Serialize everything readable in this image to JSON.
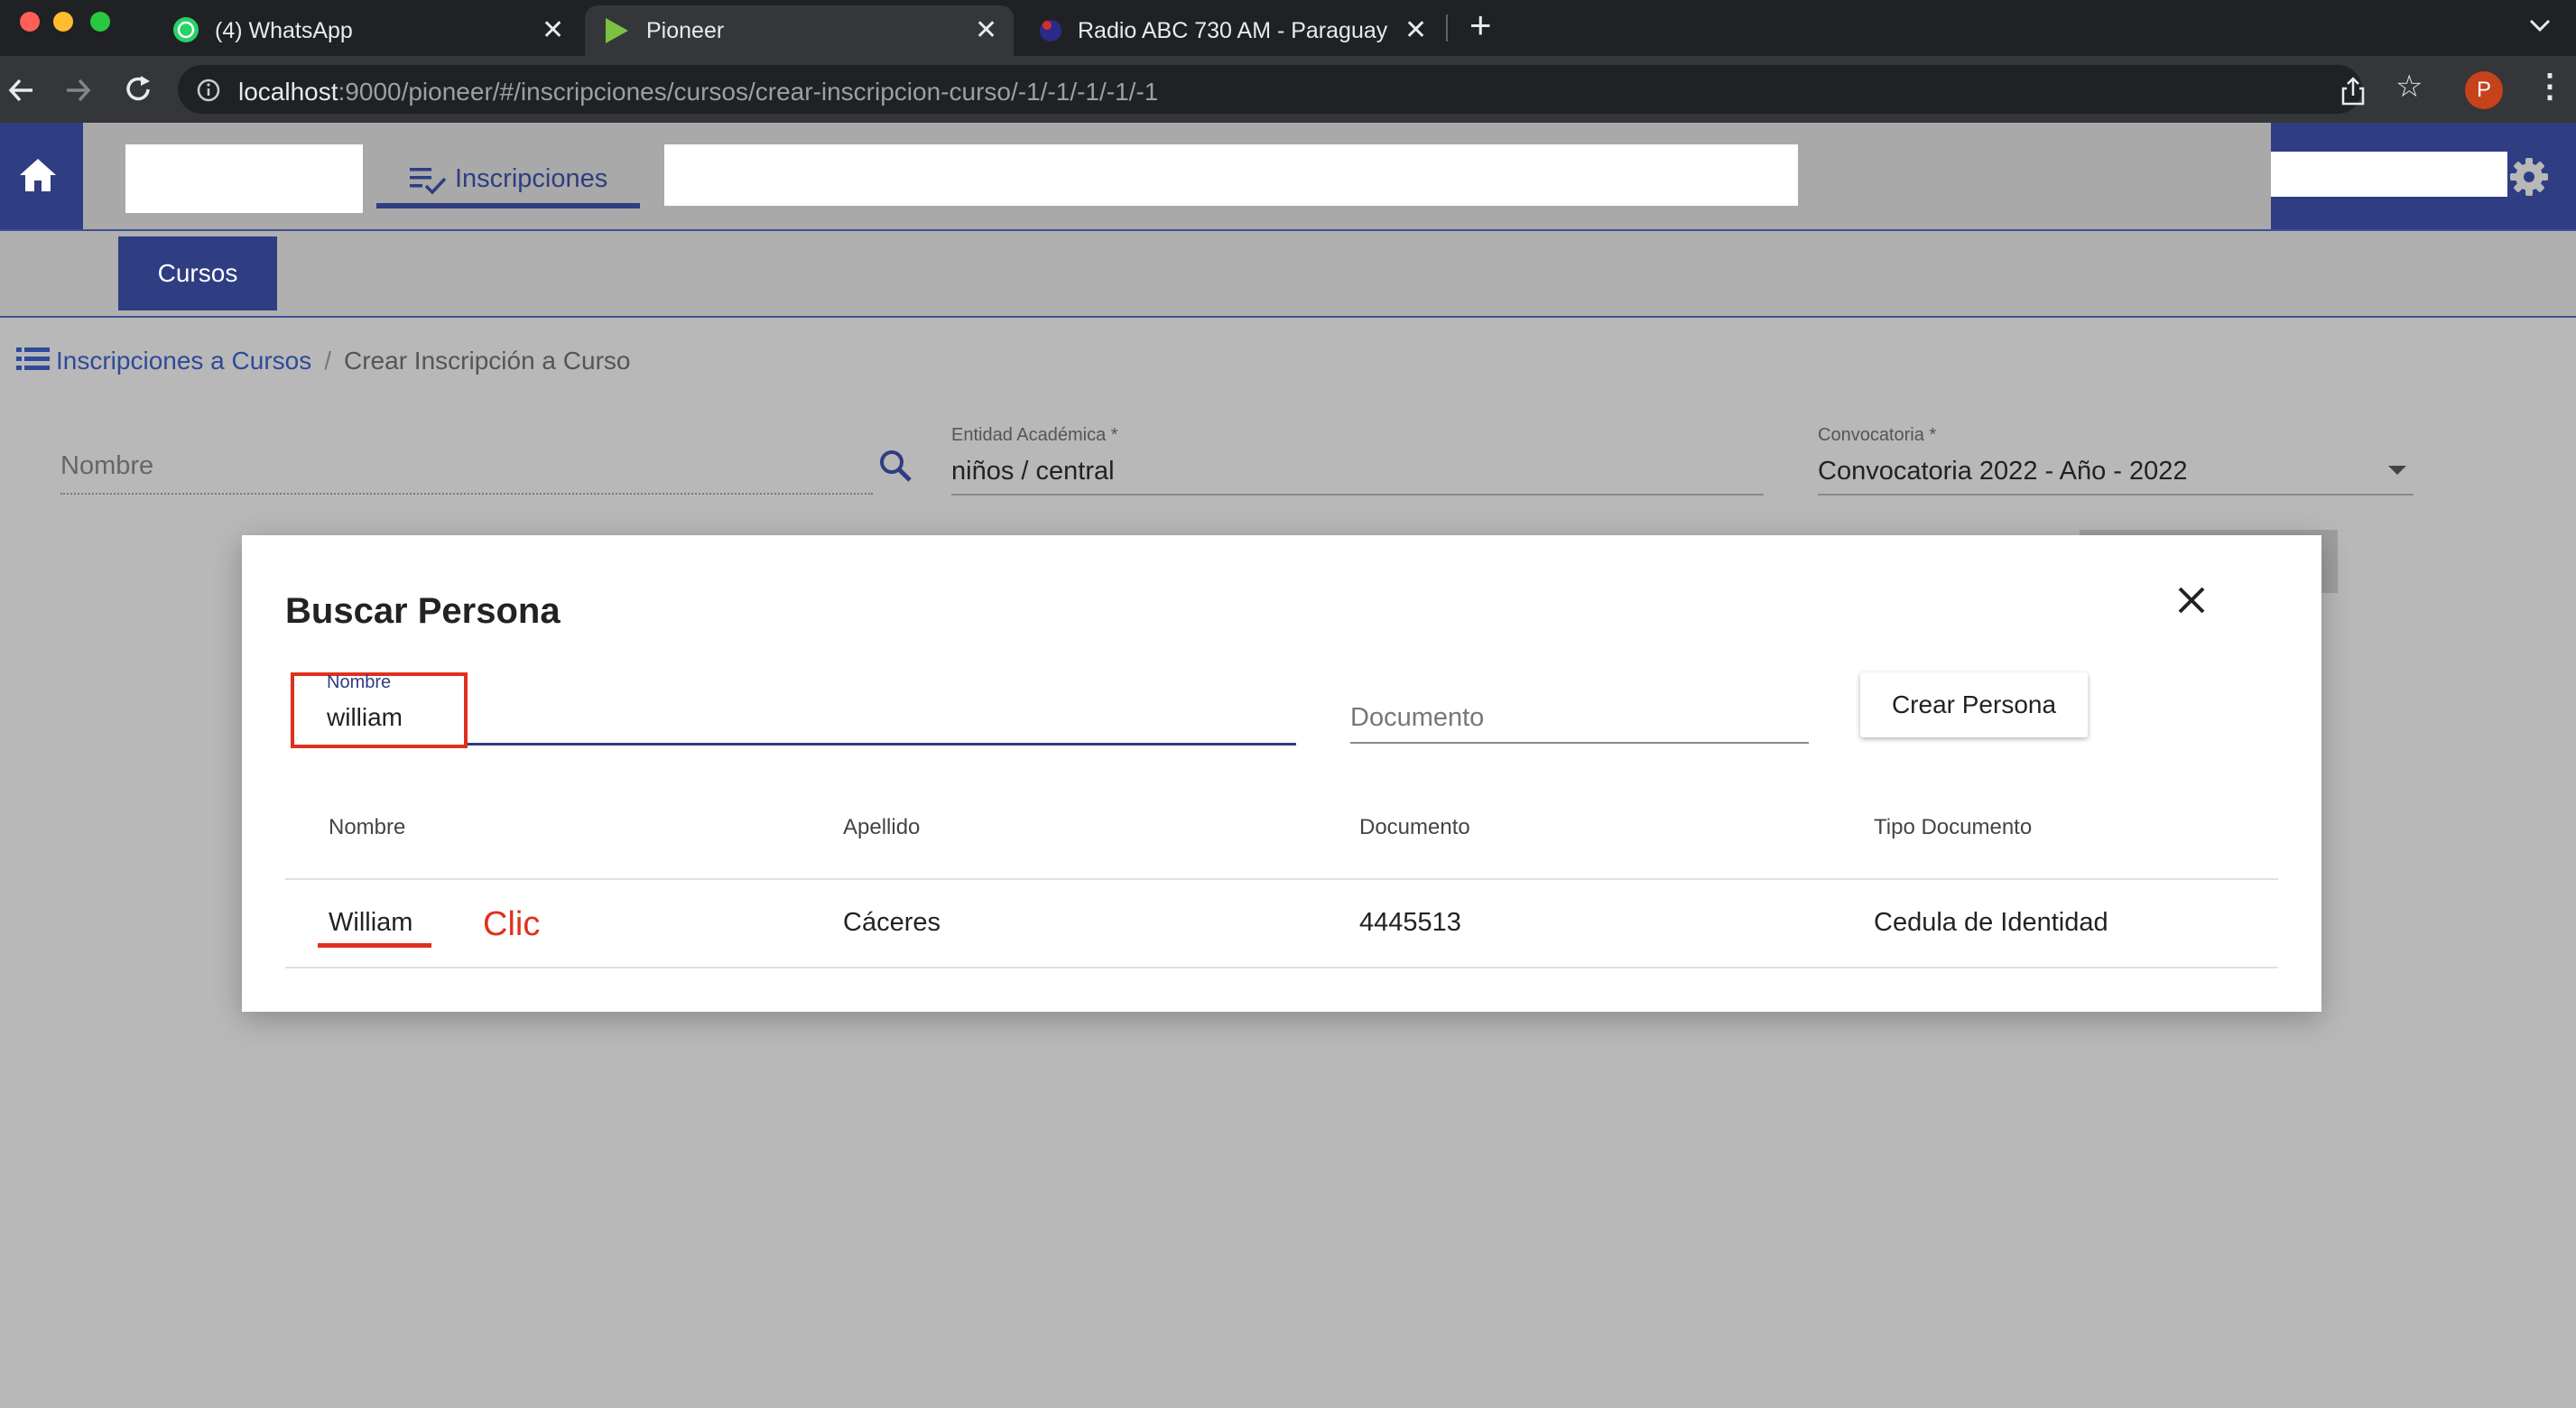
{
  "browser": {
    "tabs": [
      {
        "title": "(4) WhatsApp"
      },
      {
        "title": "Pioneer"
      },
      {
        "title": "Radio ABC 730 AM - Paraguay"
      }
    ],
    "url_host": "localhost",
    "url_rest": ":9000/pioneer/#/inscripciones/cursos/crear-inscripcion-curso/-1/-1/-1/-1/-1",
    "profile_initial": "P"
  },
  "header": {
    "nav_tab_label": "Inscripciones"
  },
  "subnav": {
    "cursos_label": "Cursos"
  },
  "breadcrumb": {
    "link": "Inscripciones a Cursos",
    "separator": "/",
    "current": "Crear Inscripción a Curso"
  },
  "form": {
    "nombre_placeholder": "Nombre",
    "entidad_label": "Entidad Académica *",
    "entidad_value": "niños / central",
    "convocatoria_label": "Convocatoria *",
    "convocatoria_value": "Convocatoria 2022 - Año - 2022"
  },
  "modal": {
    "title": "Buscar Persona",
    "nombre_label": "Nombre",
    "nombre_value": "william",
    "documento_placeholder": "Documento",
    "crear_button": "Crear Persona",
    "columns": [
      "Nombre",
      "Apellido",
      "Documento",
      "Tipo Documento"
    ],
    "rows": [
      {
        "nombre": "William",
        "apellido": "Cáceres",
        "documento": "4445513",
        "tipo": "Cedula de Identidad"
      }
    ],
    "annotation": "Clic"
  },
  "colors": {
    "primary": "#2f3d83",
    "annotation_red": "#e0301e",
    "overlay_gray": "#b8b8b8"
  }
}
